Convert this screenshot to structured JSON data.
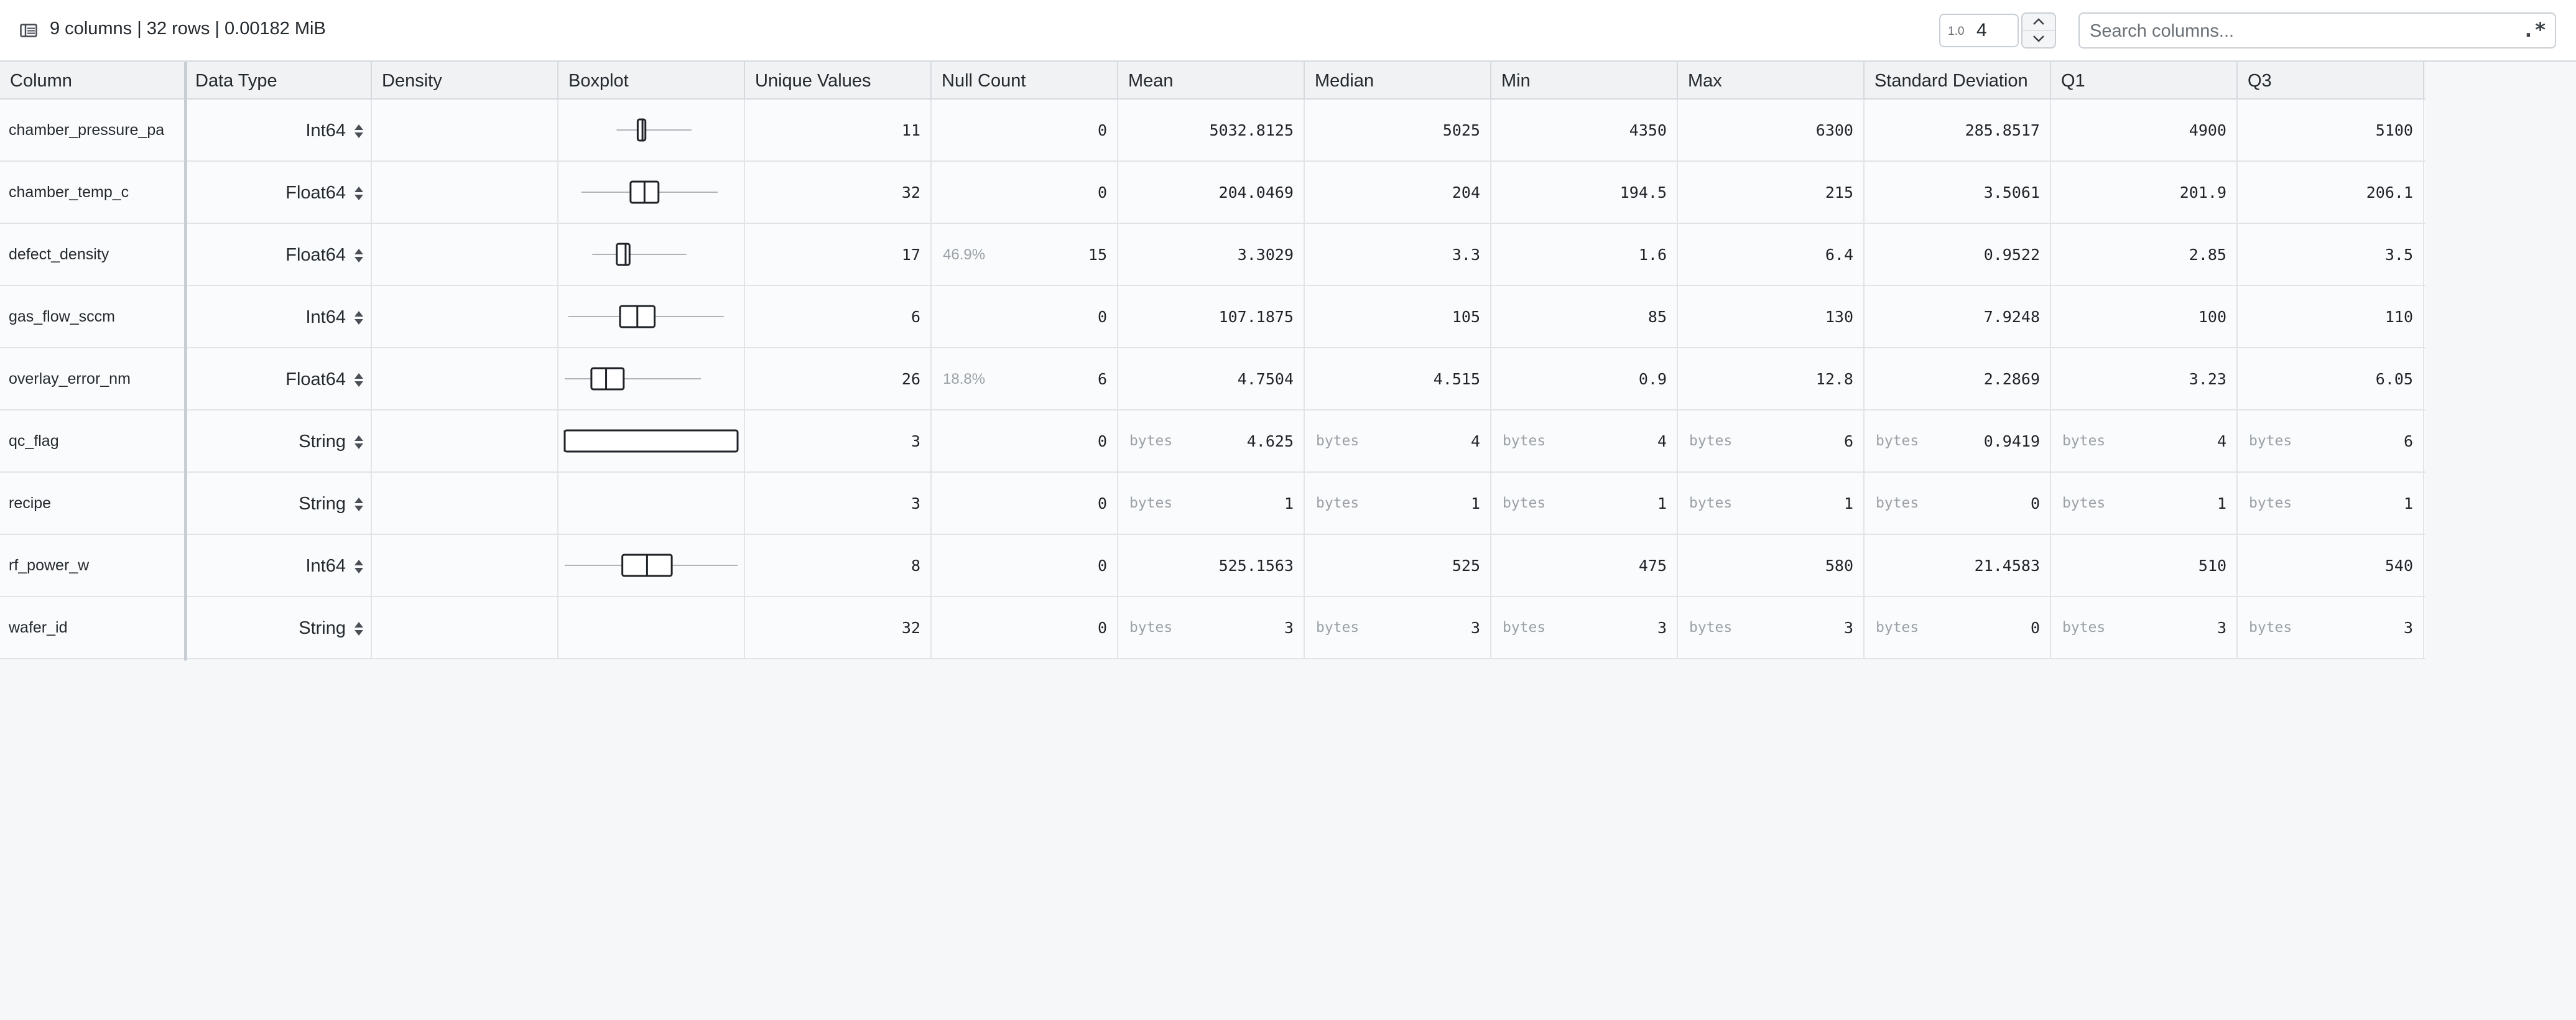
{
  "toolbar": {
    "summary": "9 columns | 32 rows | 0.00182 MiB",
    "precision_badge": "1.0",
    "precision_value": "4",
    "search_placeholder": "Search columns...",
    "regex_label": ".*"
  },
  "headers": [
    "Column",
    "Data Type",
    "Density",
    "Boxplot",
    "Unique Values",
    "Null Count",
    "Mean",
    "Median",
    "Min",
    "Max",
    "Standard Deviation",
    "Q1",
    "Q3"
  ],
  "rows": [
    {
      "column": "chamber_pressure_pa",
      "dtype": "Int64",
      "unique": "11",
      "null_pct": "",
      "null_count": "0",
      "tag": "",
      "mean": "5032.8125",
      "median": "5025",
      "min": "4350",
      "max": "6300",
      "std": "285.8517",
      "q1": "4900",
      "q3": "5100",
      "boxplot": {
        "min": 4350,
        "q1": 4900,
        "median": 5025,
        "q3": 5100,
        "max": 6300,
        "scale": [
          3000,
          7500
        ]
      }
    },
    {
      "column": "chamber_temp_c",
      "dtype": "Float64",
      "unique": "32",
      "null_pct": "",
      "null_count": "0",
      "tag": "",
      "mean": "204.0469",
      "median": "204",
      "min": "194.5",
      "max": "215",
      "std": "3.5061",
      "q1": "201.9",
      "q3": "206.1",
      "boxplot": {
        "min": 194.5,
        "q1": 201.9,
        "median": 204,
        "q3": 206.1,
        "max": 215,
        "scale": [
          192,
          218
        ]
      }
    },
    {
      "column": "defect_density",
      "dtype": "Float64",
      "unique": "17",
      "null_pct": "46.9%",
      "null_count": "15",
      "tag": "",
      "mean": "3.3029",
      "median": "3.3",
      "min": "1.6",
      "max": "6.4",
      "std": "0.9522",
      "q1": "2.85",
      "q3": "3.5",
      "boxplot": {
        "min": 1.6,
        "q1": 2.85,
        "median": 3.3,
        "q3": 3.5,
        "max": 6.4,
        "scale": [
          0.2,
          9.0
        ]
      }
    },
    {
      "column": "gas_flow_sccm",
      "dtype": "Int64",
      "unique": "6",
      "null_pct": "",
      "null_count": "0",
      "tag": "",
      "mean": "107.1875",
      "median": "105",
      "min": "85",
      "max": "130",
      "std": "7.9248",
      "q1": "100",
      "q3": "110",
      "boxplot": {
        "min": 85,
        "q1": 100,
        "median": 105,
        "q3": 110,
        "max": 130,
        "scale": [
          84,
          134
        ]
      }
    },
    {
      "column": "overlay_error_nm",
      "dtype": "Float64",
      "unique": "26",
      "null_pct": "18.8%",
      "null_count": "6",
      "tag": "",
      "mean": "4.7504",
      "median": "4.515",
      "min": "0.9",
      "max": "12.8",
      "std": "2.2869",
      "q1": "3.23",
      "q3": "6.05",
      "boxplot": {
        "min": 0.9,
        "q1": 3.23,
        "median": 4.515,
        "q3": 6.05,
        "max": 12.8,
        "scale": [
          0.9,
          16
        ]
      }
    },
    {
      "column": "qc_flag",
      "dtype": "String",
      "unique": "3",
      "null_pct": "",
      "null_count": "0",
      "tag": "bytes",
      "mean": "4.625",
      "median": "4",
      "min": "4",
      "max": "6",
      "std": "0.9419",
      "q1": "4",
      "q3": "6",
      "boxplot": {
        "min": 4,
        "q1": 4,
        "median": 4,
        "q3": 6,
        "max": 6,
        "scale": [
          4,
          6
        ]
      }
    },
    {
      "column": "recipe",
      "dtype": "String",
      "unique": "3",
      "null_pct": "",
      "null_count": "0",
      "tag": "bytes",
      "mean": "1",
      "median": "1",
      "min": "1",
      "max": "1",
      "std": "0",
      "q1": "1",
      "q3": "1",
      "boxplot": null
    },
    {
      "column": "rf_power_w",
      "dtype": "Int64",
      "unique": "8",
      "null_pct": "",
      "null_count": "0",
      "tag": "",
      "mean": "525.1563",
      "median": "525",
      "min": "475",
      "max": "580",
      "std": "21.4583",
      "q1": "510",
      "q3": "540",
      "boxplot": {
        "min": 475,
        "q1": 510,
        "median": 525,
        "q3": 540,
        "max": 580,
        "scale": [
          475,
          580
        ]
      }
    },
    {
      "column": "wafer_id",
      "dtype": "String",
      "unique": "32",
      "null_pct": "",
      "null_count": "0",
      "tag": "bytes",
      "mean": "3",
      "median": "3",
      "min": "3",
      "max": "3",
      "std": "0",
      "q1": "3",
      "q3": "3",
      "boxplot": null
    }
  ]
}
